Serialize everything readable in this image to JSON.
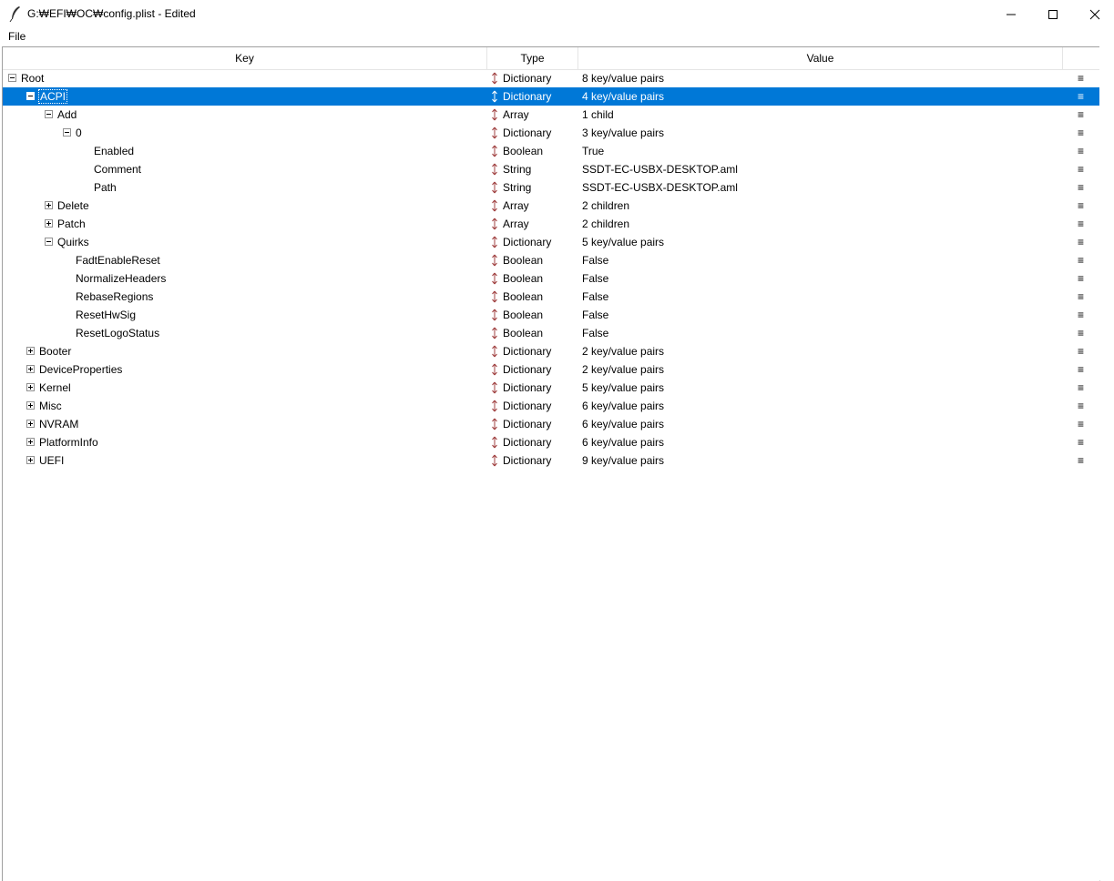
{
  "window": {
    "title": "G:₩EFI₩OC₩config.plist - Edited",
    "controls": {
      "minimize": "minimize",
      "maximize": "maximize",
      "close": "close"
    }
  },
  "menu": {
    "file": "File"
  },
  "columns": {
    "key": "Key",
    "type": "Type",
    "value": "Value"
  },
  "row_menu_glyph": "≡",
  "rows": [
    {
      "key": "Root",
      "type": "Dictionary",
      "value": "8 key/value pairs",
      "level": 0,
      "expander": "minus"
    },
    {
      "key": "ACPI",
      "type": "Dictionary",
      "value": "4 key/value pairs",
      "level": 1,
      "expander": "minus",
      "selected": true
    },
    {
      "key": "Add",
      "type": "Array",
      "value": "1 child",
      "level": 2,
      "expander": "minus"
    },
    {
      "key": "0",
      "type": "Dictionary",
      "value": "3 key/value pairs",
      "level": 3,
      "expander": "minus"
    },
    {
      "key": "Enabled",
      "type": "Boolean",
      "value": "True",
      "level": 4,
      "expander": null
    },
    {
      "key": "Comment",
      "type": "String",
      "value": "SSDT-EC-USBX-DESKTOP.aml",
      "level": 4,
      "expander": null
    },
    {
      "key": "Path",
      "type": "String",
      "value": "SSDT-EC-USBX-DESKTOP.aml",
      "level": 4,
      "expander": null
    },
    {
      "key": "Delete",
      "type": "Array",
      "value": "2 children",
      "level": 2,
      "expander": "plus"
    },
    {
      "key": "Patch",
      "type": "Array",
      "value": "2 children",
      "level": 2,
      "expander": "plus"
    },
    {
      "key": "Quirks",
      "type": "Dictionary",
      "value": "5 key/value pairs",
      "level": 2,
      "expander": "minus"
    },
    {
      "key": "FadtEnableReset",
      "type": "Boolean",
      "value": "False",
      "level": 3,
      "expander": null
    },
    {
      "key": "NormalizeHeaders",
      "type": "Boolean",
      "value": "False",
      "level": 3,
      "expander": null
    },
    {
      "key": "RebaseRegions",
      "type": "Boolean",
      "value": "False",
      "level": 3,
      "expander": null
    },
    {
      "key": "ResetHwSig",
      "type": "Boolean",
      "value": "False",
      "level": 3,
      "expander": null
    },
    {
      "key": "ResetLogoStatus",
      "type": "Boolean",
      "value": "False",
      "level": 3,
      "expander": null
    },
    {
      "key": "Booter",
      "type": "Dictionary",
      "value": "2 key/value pairs",
      "level": 1,
      "expander": "plus"
    },
    {
      "key": "DeviceProperties",
      "type": "Dictionary",
      "value": "2 key/value pairs",
      "level": 1,
      "expander": "plus"
    },
    {
      "key": "Kernel",
      "type": "Dictionary",
      "value": "5 key/value pairs",
      "level": 1,
      "expander": "plus"
    },
    {
      "key": "Misc",
      "type": "Dictionary",
      "value": "6 key/value pairs",
      "level": 1,
      "expander": "plus"
    },
    {
      "key": "NVRAM",
      "type": "Dictionary",
      "value": "6 key/value pairs",
      "level": 1,
      "expander": "plus"
    },
    {
      "key": "PlatformInfo",
      "type": "Dictionary",
      "value": "6 key/value pairs",
      "level": 1,
      "expander": "plus"
    },
    {
      "key": "UEFI",
      "type": "Dictionary",
      "value": "9 key/value pairs",
      "level": 1,
      "expander": "plus"
    }
  ],
  "colors": {
    "selection": "#0078d7",
    "arrow": "#a04040"
  }
}
